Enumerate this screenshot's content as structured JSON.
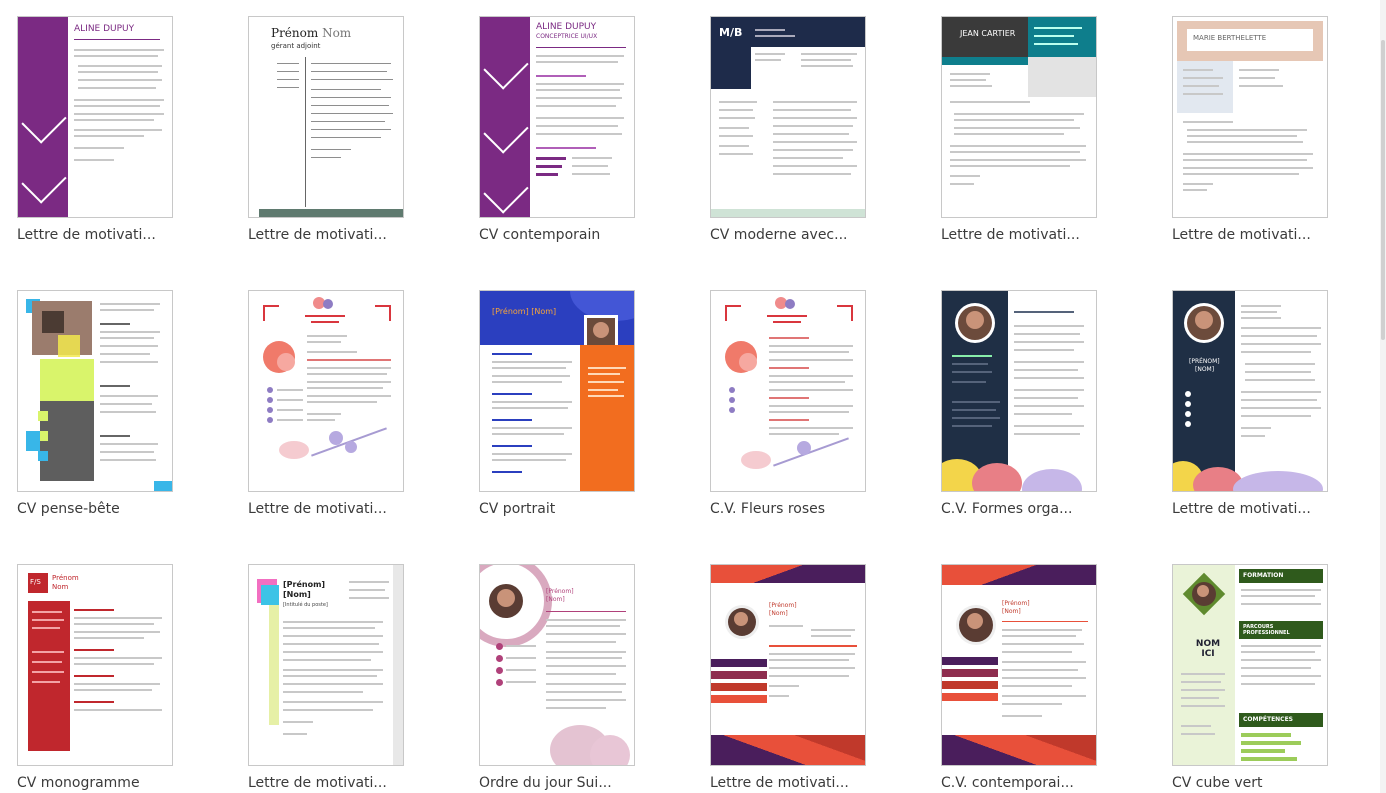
{
  "templates": [
    {
      "caption": "Lettre de motivati..."
    },
    {
      "caption": "Lettre de motivati...",
      "name_first": "Prénom",
      "name_last": "Nom",
      "subtitle": "gérant adjoint"
    },
    {
      "caption": "CV contemporain",
      "name": "ALINE DUPUY",
      "role": "CONCEPTRICE UI/UX"
    },
    {
      "caption": "CV moderne avec...",
      "monogram": "M/B"
    },
    {
      "caption": "Lettre de motivati...",
      "name": "JEAN CARTIER"
    },
    {
      "caption": "Lettre de motivati...",
      "name": "MARIE BERTHELETTE"
    },
    {
      "caption": "CV pense-bête"
    },
    {
      "caption": "Lettre de motivati..."
    },
    {
      "caption": "CV portrait",
      "name": "[Prénom] [Nom]"
    },
    {
      "caption": "C.V. Fleurs roses"
    },
    {
      "caption": "C.V. Formes orga..."
    },
    {
      "caption": "Lettre de motivati..."
    },
    {
      "caption": "CV monogramme",
      "monogram": "F/S"
    },
    {
      "caption": "Lettre de motivati..."
    },
    {
      "caption": "Ordre du jour Sui..."
    },
    {
      "caption": "Lettre de motivati..."
    },
    {
      "caption": "C.V. contemporai..."
    },
    {
      "caption": "CV cube vert",
      "name": "NOM ICI"
    }
  ]
}
